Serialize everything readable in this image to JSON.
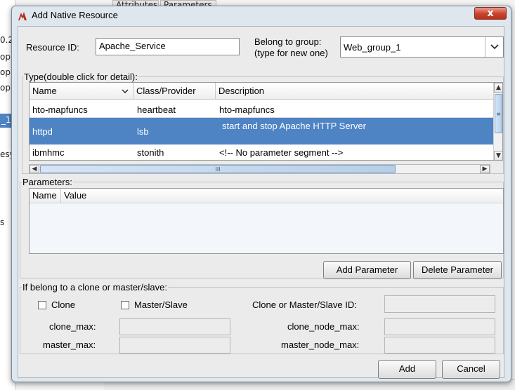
{
  "background": {
    "tabs": [
      "Attributes",
      "Parameters"
    ],
    "sidebar_fragments": [
      "0.2",
      "op",
      "op",
      "op",
      "_1",
      "esy",
      "s"
    ]
  },
  "dialog": {
    "title": "Add Native Resource",
    "close_glyph": "x",
    "resource_id": {
      "label": "Resource ID:",
      "value": "Apache_Service"
    },
    "group": {
      "label_line1": "Belong to group:",
      "label_line2": "(type for new one)",
      "value": "Web_group_1"
    },
    "type_section": {
      "title": "Type(double click for detail):",
      "columns": [
        "Name",
        "Class/Provider",
        "Description"
      ],
      "rows": [
        {
          "name": "hto-mapfuncs",
          "provider": "heartbeat",
          "description": "hto-mapfuncs"
        },
        {
          "name": "httpd",
          "provider": "lsb",
          "description": "start and stop Apache HTTP Server"
        },
        {
          "name": "ibmhmc",
          "provider": "stonith",
          "description": "<!-- No parameter segment -->"
        }
      ],
      "selected_row": 1,
      "hscroll_grip": "III",
      "vscroll_grip": "≡"
    },
    "parameters_section": {
      "title": "Parameters:",
      "columns": [
        "Name",
        "Value"
      ],
      "add_button": "Add Parameter",
      "delete_button": "Delete Parameter"
    },
    "clone_section": {
      "title": "If belong to a clone or master/slave:",
      "clone_label": "Clone",
      "clone_checked": false,
      "master_slave_label": "Master/Slave",
      "master_slave_checked": false,
      "clone_id_label": "Clone or Master/Slave ID:",
      "clone_max_label": "clone_max:",
      "clone_node_max_label": "clone_node_max:",
      "master_max_label": "master_max:",
      "master_node_max_label": "master_node_max:"
    },
    "buttons": {
      "add": "Add",
      "cancel": "Cancel"
    }
  }
}
